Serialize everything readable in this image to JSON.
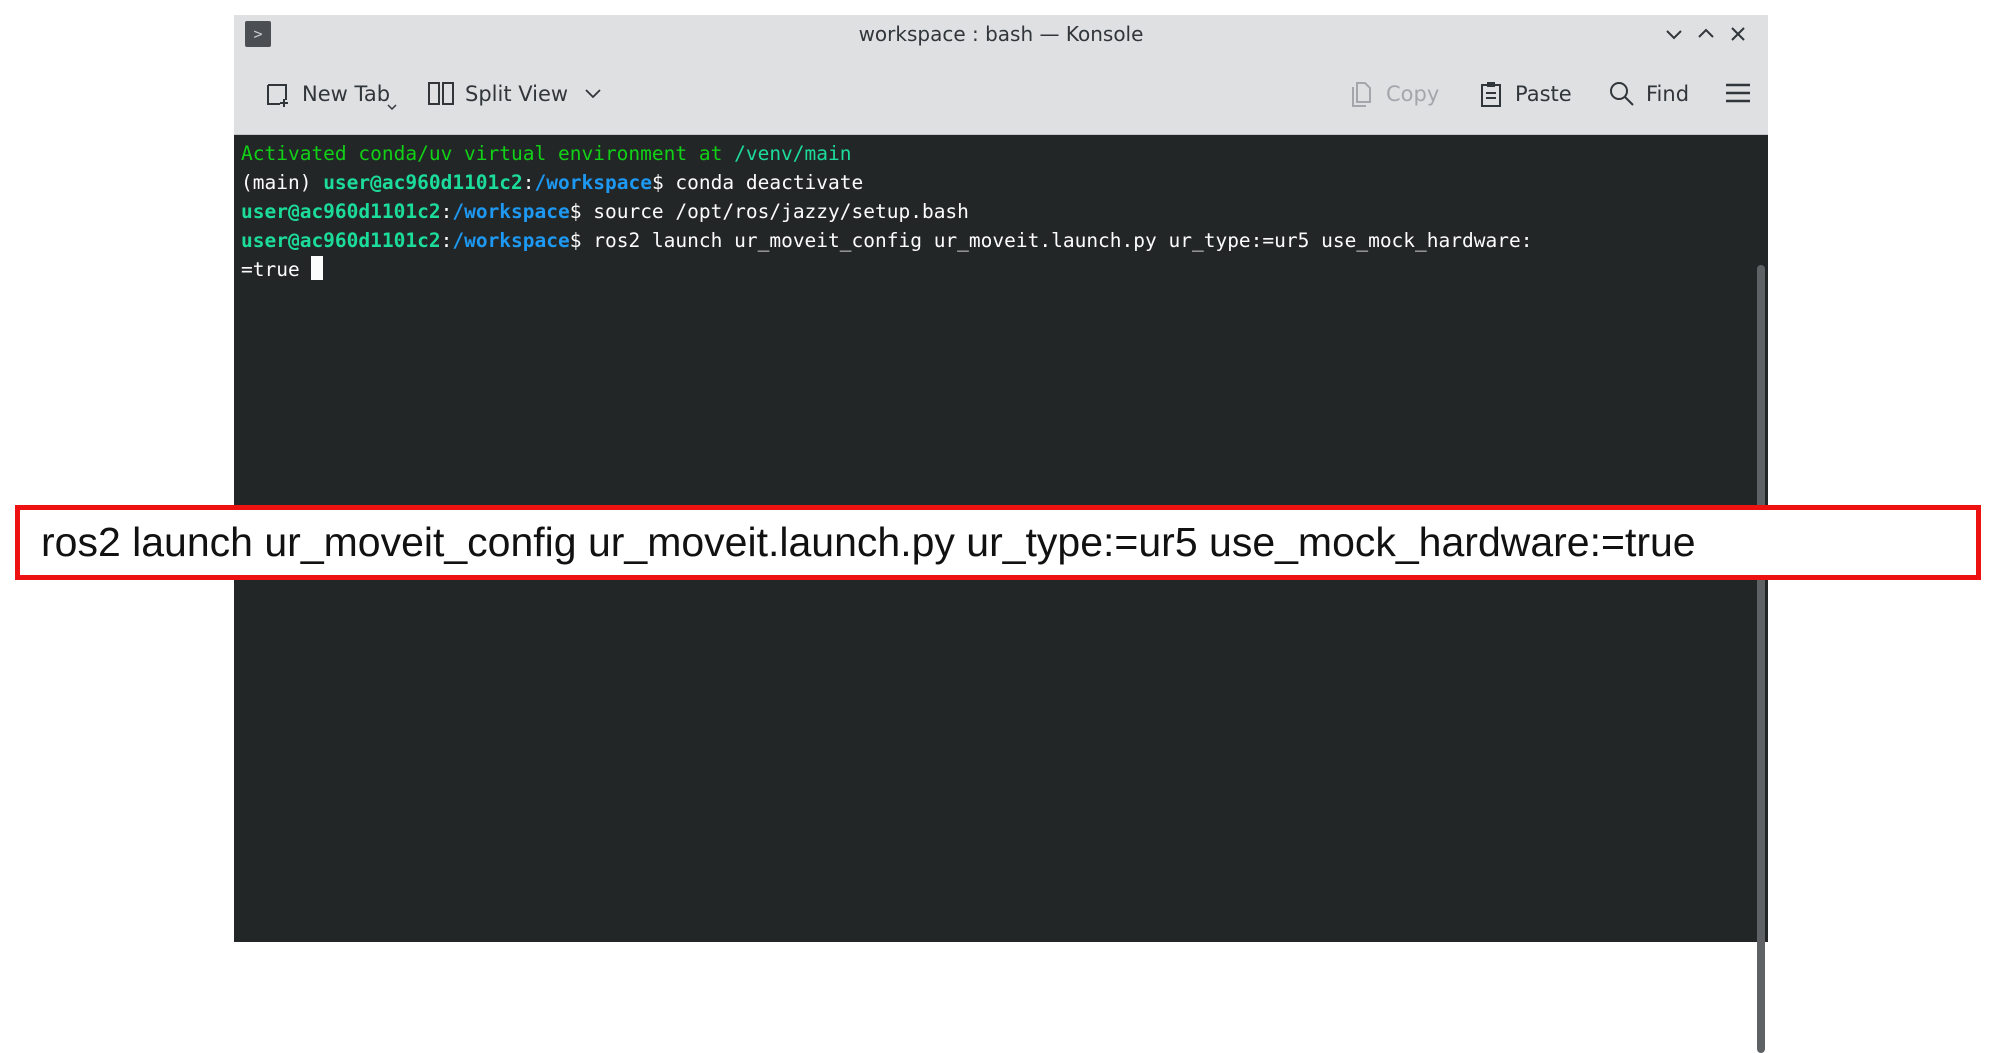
{
  "window": {
    "title": "workspace : bash — Konsole"
  },
  "toolbar": {
    "new_tab": "New Tab",
    "split_view": "Split View",
    "copy": "Copy",
    "paste": "Paste",
    "find": "Find"
  },
  "terminal": {
    "line1_msg": "Activated conda/uv virtual environment at ",
    "line1_path": "/venv/main",
    "env_prefix": "(main) ",
    "user_host": "user@ac960d1101c2",
    "colon": ":",
    "cwd": "/workspace",
    "prompt_symbol": "$ ",
    "cmd1": "conda deactivate",
    "cmd2": "source /opt/ros/jazzy/setup.bash",
    "cmd3_part1": "ros2 launch ur_moveit_config ur_moveit.launch.py ur_type:=ur5 use_mock_hardware:",
    "cmd3_part2": "=true "
  },
  "annotation": {
    "text": "ros2 launch ur_moveit_config ur_moveit.launch.py ur_type:=ur5 use_mock_hardware:=true",
    "border_color": "#ee1111"
  },
  "colors": {
    "terminal_bg": "#232627",
    "user_host": "#1cdc9a",
    "cwd": "#1d99f3",
    "activation_msg": "#11d116"
  }
}
